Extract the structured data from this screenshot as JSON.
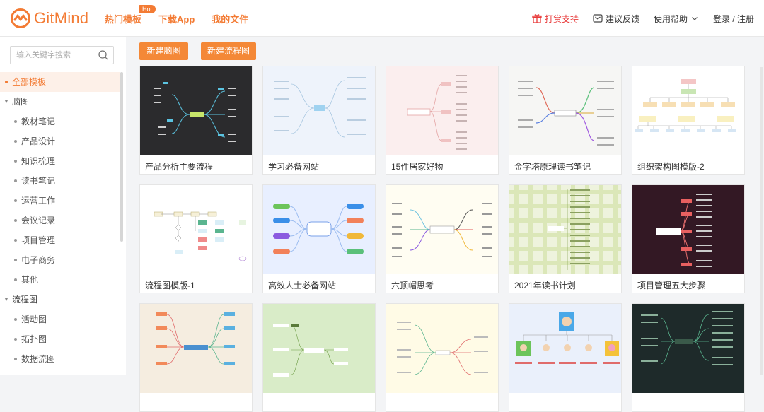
{
  "app": {
    "brand": "GitMind",
    "accent": "#f37b34"
  },
  "nav": {
    "hot_templates": "热门模板",
    "hot_badge": "Hot",
    "download": "下载App",
    "my_files": "我的文件"
  },
  "right_nav": {
    "reward": "打赏支持",
    "feedback": "建议反馈",
    "help": "使用帮助",
    "login": "登录 / 注册"
  },
  "search": {
    "placeholder": "输入关键字搜索"
  },
  "sidebar": {
    "all": "全部模板",
    "mindmap_group": "脑图",
    "mindmap_items": [
      "教材笔记",
      "产品设计",
      "知识梳理",
      "读书笔记",
      "运营工作",
      "会议记录",
      "项目管理",
      "电子商务",
      "其他"
    ],
    "flow_group": "流程图",
    "flow_items": [
      "活动图",
      "拓扑图",
      "数据流图"
    ]
  },
  "actions": {
    "new_mindmap": "新建脑图",
    "new_flowchart": "新建流程图"
  },
  "cards": [
    {
      "title": "产品分析主要流程",
      "icon": "dark-mindmap-thumbnail"
    },
    {
      "title": "学习必备网站",
      "icon": "light-blue-mindmap-thumbnail"
    },
    {
      "title": "15件居家好物",
      "icon": "pink-mindmap-thumbnail"
    },
    {
      "title": "金字塔原理读书笔记",
      "icon": "colorful-mindmap-thumbnail"
    },
    {
      "title": "组织架构图模版-2",
      "icon": "org-chart-thumbnail"
    },
    {
      "title": "流程图模版-1",
      "icon": "flowchart-thumbnail"
    },
    {
      "title": "高效人士必备网站",
      "icon": "blue-mindmap-thumbnail"
    },
    {
      "title": "六顶帽思考",
      "icon": "cream-mindmap-thumbnail"
    },
    {
      "title": "2021年读书计划",
      "icon": "green-grid-thumbnail"
    },
    {
      "title": "项目管理五大步骤",
      "icon": "dark-red-thumbnail"
    },
    {
      "title": "",
      "icon": "beige-mindmap-thumbnail"
    },
    {
      "title": "",
      "icon": "green-mindmap-thumbnail"
    },
    {
      "title": "",
      "icon": "yellow-mindmap-thumbnail"
    },
    {
      "title": "",
      "icon": "avatar-tree-thumbnail"
    },
    {
      "title": "",
      "icon": "dark-green-thumbnail"
    }
  ]
}
